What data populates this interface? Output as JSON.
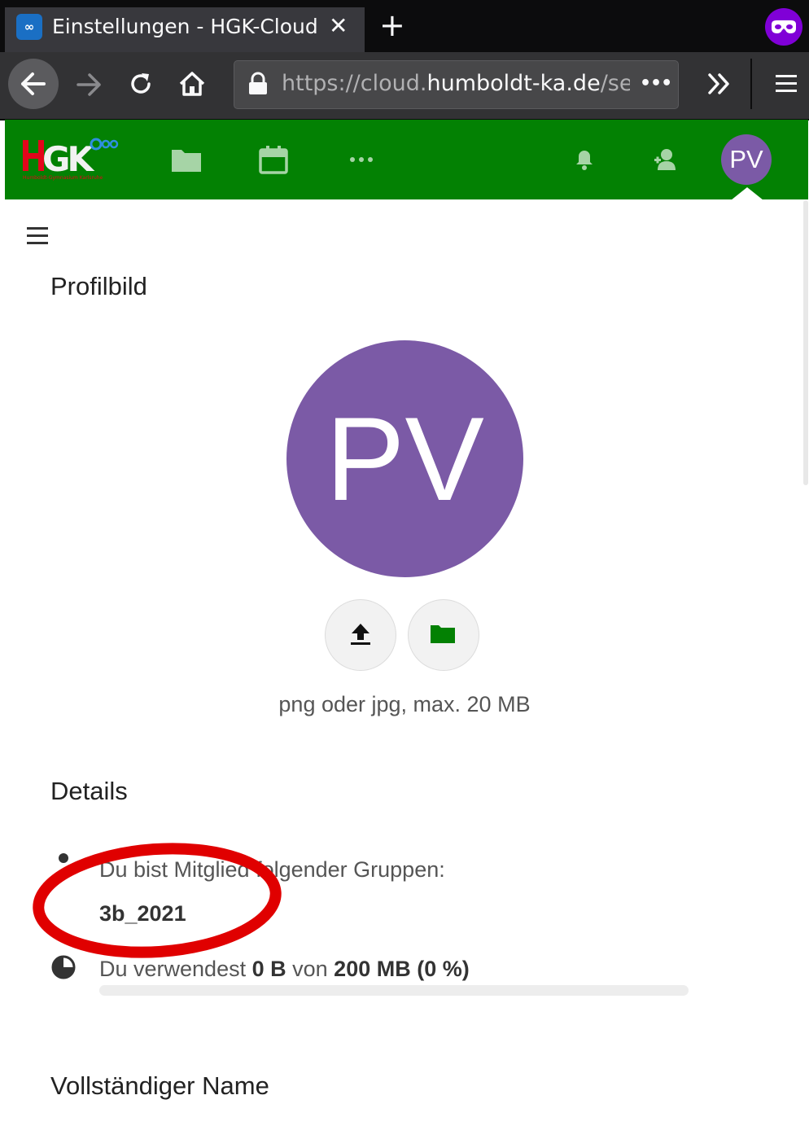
{
  "browser": {
    "tab": {
      "title": "Einstellungen - HGK-Cloud",
      "favicon": "nextcloud-favicon",
      "favicon_glyph": "∞",
      "close_glyph": "✕"
    },
    "new_tab_glyph": "+",
    "url": {
      "scheme": "https://",
      "subdomain": "cloud.",
      "domain": "humboldt-ka.de",
      "path": "/se"
    },
    "url_more_glyph": "•••",
    "icons": [
      "back-arrow-icon",
      "forward-arrow-icon",
      "reload-icon",
      "home-icon",
      "lock-icon",
      "page-actions-icon",
      "overflow-chevron-icon",
      "hamburger-menu-icon",
      "private-browsing-mask-icon"
    ]
  },
  "header": {
    "logo_text": "HGK",
    "logo_subtext": "Humboldt-Gymnasium Karlsruhe",
    "apps": [
      "files-icon",
      "calendar-icon",
      "more-apps-icon"
    ],
    "right_icons": [
      "notifications-bell-icon",
      "contacts-icon"
    ],
    "avatar_initials": "PV",
    "background_color": "#038103"
  },
  "content": {
    "profile_picture": {
      "heading": "Profilbild",
      "avatar_initials": "PV",
      "avatar_color": "#7b5aa6",
      "hint": "png oder jpg, max. 20 MB"
    },
    "details": {
      "heading": "Details",
      "groups_label": "Du bist Mitglied folgender Gruppen:",
      "groups": [
        "3b_2021"
      ],
      "quota_prefix": "Du verwendest ",
      "quota_used": "0 B",
      "quota_mid": " von ",
      "quota_total": "200 MB",
      "quota_percent": "(0 %)",
      "quota_fraction": 0
    },
    "full_name": {
      "heading": "Vollständiger Name"
    }
  },
  "annotation": {
    "color": "#e00000",
    "shape": "ellipse",
    "highlights": "group-name"
  }
}
